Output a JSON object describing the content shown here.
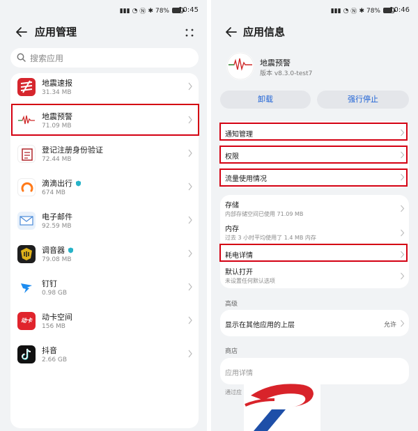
{
  "status_bar_left": {
    "battery": "78%",
    "time": "10:45"
  },
  "status_bar_right": {
    "battery": "78%",
    "time": "10:46"
  },
  "app_manager": {
    "title": "应用管理",
    "search_placeholder": "搜索应用",
    "apps": [
      {
        "name": "地震速报",
        "size": "31.34 MB",
        "icon": "earthquake-news-icon"
      },
      {
        "name": "地震预警",
        "size": "71.09 MB",
        "icon": "earthquake-warning-icon"
      },
      {
        "name": "登记注册身份验证",
        "size": "72.44 MB",
        "icon": "id-verify-icon"
      },
      {
        "name": "滴滴出行",
        "size": "674 MB",
        "icon": "didi-icon"
      },
      {
        "name": "电子邮件",
        "size": "92.59 MB",
        "icon": "email-icon"
      },
      {
        "name": "调音器",
        "size": "79.08 MB",
        "icon": "tuner-icon"
      },
      {
        "name": "钉钉",
        "size": "0.98 GB",
        "icon": "dingtalk-icon"
      },
      {
        "name": "动卡空间",
        "size": "156 MB",
        "icon": "dongka-icon"
      },
      {
        "name": "抖音",
        "size": "2.66 GB",
        "icon": "douyin-icon"
      }
    ],
    "dongka_icon_text": "动卡"
  },
  "app_info": {
    "title": "应用信息",
    "app_name": "地震预警",
    "version": "版本 v8.3.0-test7",
    "uninstall": "卸载",
    "force_stop": "强行停止",
    "notifications": "通知管理",
    "permissions": "权限",
    "data_usage": "流量使用情况",
    "storage": "存储",
    "storage_sub": "内部存储空间已使用 71.09 MB",
    "memory": "内存",
    "memory_sub": "过去 3 小时平均使用了 1.4 MB 内存",
    "battery": "耗电详情",
    "open_default": "默认打开",
    "open_default_sub": "未设置任何默认选项",
    "advanced_section": "高级",
    "display_over": "显示在其他应用的上层",
    "allow": "允许",
    "store_section": "商店",
    "app_details": "应用详情",
    "via_partial": "通过应"
  }
}
